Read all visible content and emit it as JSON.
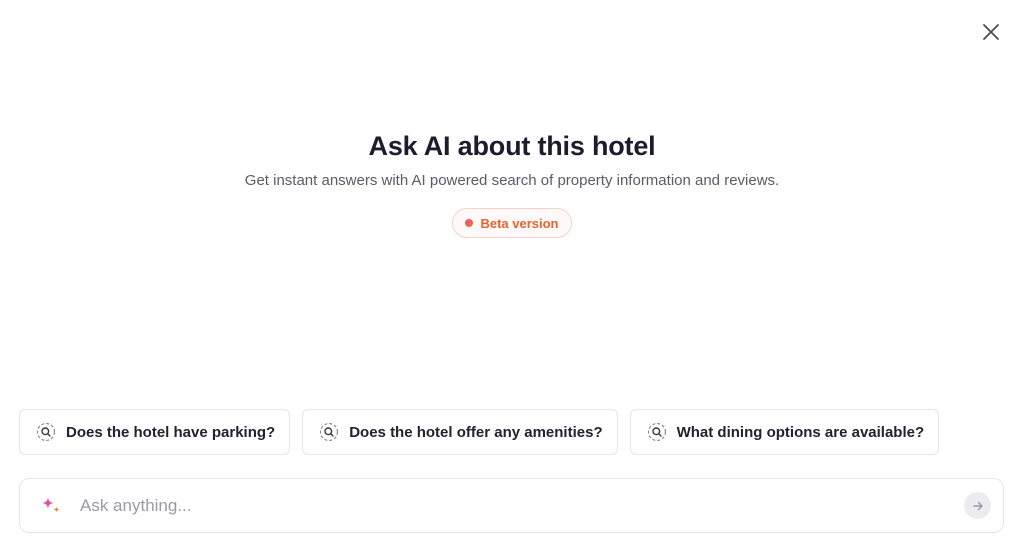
{
  "header": {
    "close_icon": "close-icon"
  },
  "hero": {
    "title": "Ask AI about this hotel",
    "subtitle": "Get instant answers with AI powered search of property information and reviews.",
    "badge_label": "Beta version",
    "badge_color": "#e8622e"
  },
  "suggestions": [
    {
      "icon": "search-icon",
      "label": "Does the hotel have parking?"
    },
    {
      "icon": "search-icon",
      "label": "Does the hotel offer any amenities?"
    },
    {
      "icon": "search-icon",
      "label": "What dining options are available?"
    }
  ],
  "ask_bar": {
    "icon": "sparkle-icon",
    "placeholder": "Ask anything...",
    "value": "",
    "send_icon": "arrow-right-icon"
  }
}
